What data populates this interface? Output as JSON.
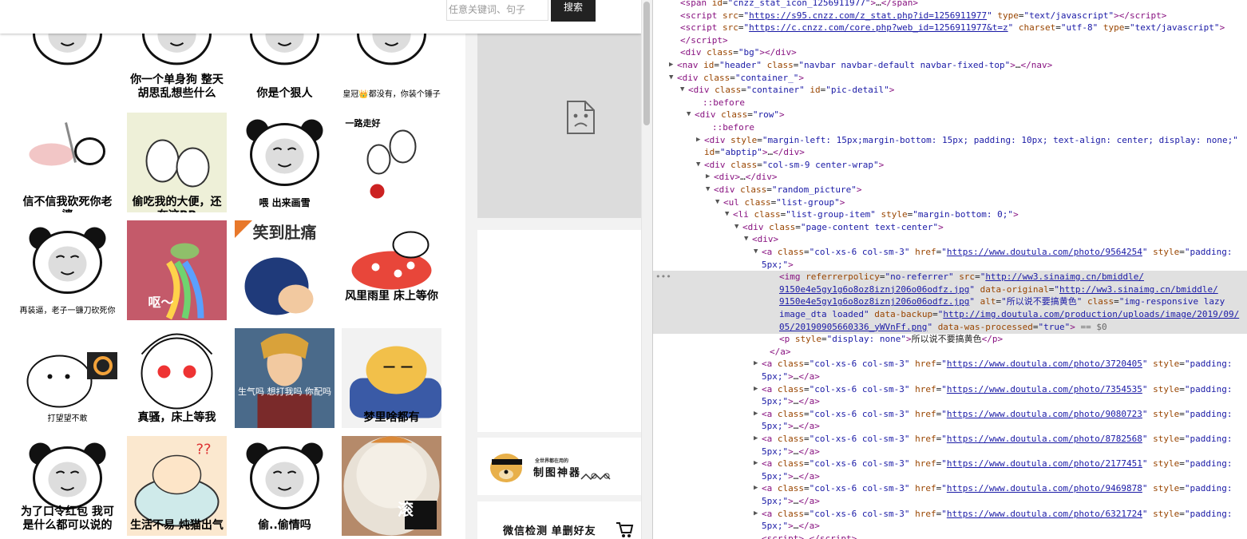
{
  "navbar": {
    "search_placeholder": "任意关键词、句子",
    "search_button": "搜索"
  },
  "memes": [
    {
      "caption": ""
    },
    {
      "caption": "你一个单身狗\n整天胡思乱想些什么"
    },
    {
      "caption": "你是个狠人"
    },
    {
      "caption": "皇冠👑都没有，你装个锤子"
    },
    {
      "caption": "信不信我砍死你老婆"
    },
    {
      "caption": "偷吃我的大便，还在这BB"
    },
    {
      "caption": "喂    出来画雪"
    },
    {
      "caption": "一路走好"
    },
    {
      "caption": "再装逼，老子一镰刀砍死你"
    },
    {
      "caption": "呕～"
    },
    {
      "caption": "笑到肚痛"
    },
    {
      "caption": "风里雨里\n床上等你"
    },
    {
      "caption": "打望望不敢"
    },
    {
      "caption": "真骚，床上等我"
    },
    {
      "caption": "生气吗 想打我吗 你配吗"
    },
    {
      "caption": "梦里啥都有"
    },
    {
      "caption": "为了口令红包\n我可是什么都可以说的"
    },
    {
      "caption": "生活不易 炖猫出气"
    },
    {
      "caption": "偷..偷情吗"
    },
    {
      "caption": "滚"
    }
  ],
  "ads": {
    "tool_small": "全世界都在用的",
    "tool_title": "制图神器",
    "wechat": "微信检测 单删好友"
  },
  "devtools": {
    "lines": [
      {
        "indent": 34,
        "html": "<span class='tag'>&lt;span</span> <span class='an'>id</span>=<span class='av'>\"cnzz_stat_icon_1256911977\"</span><span class='tag'>&gt;</span>…<span class='tag'>&lt;/span&gt;</span>"
      },
      {
        "indent": 34,
        "html": "<span class='tag'>&lt;script</span> <span class='an'>src</span>=<span class='av'>\"</span><span class='lnk'>https://s95.cnzz.com/z_stat.php?id=1256911977</span><span class='av'>\"</span> <span class='an'>type</span>=<span class='av'>\"text/javascript\"</span><span class='tag'>&gt;&lt;/script&gt;</span>"
      },
      {
        "indent": 34,
        "html": "<span class='tag'>&lt;script</span> <span class='an'>src</span>=<span class='av'>\"</span><span class='lnk'>https://c.cnzz.com/core.php?web_id=1256911977&amp;t=z</span><span class='av'>\"</span> <span class='an'>charset</span>=<span class='av'>\"utf-8\"</span> <span class='an'>type</span>=<span class='av'>\"text/javascript\"</span><span class='tag'>&gt;</span>"
      },
      {
        "indent": 34,
        "html": "<span class='tag'>&lt;/script&gt;</span>"
      },
      {
        "indent": 34,
        "html": "<span class='tag'>&lt;div</span> <span class='an'>class</span>=<span class='av'>\"bg\"</span><span class='tag'>&gt;&lt;/div&gt;</span>"
      },
      {
        "indent": 30,
        "tri": "▶",
        "html": "<span class='tag'>&lt;nav</span> <span class='an'>id</span>=<span class='av'>\"header\"</span> <span class='an'>class</span>=<span class='av'>\"navbar navbar-default navbar-fixed-top\"</span><span class='tag'>&gt;</span>…<span class='tag'>&lt;/nav&gt;</span>"
      },
      {
        "indent": 30,
        "tri": "▼",
        "html": "<span class='tag'>&lt;div</span> <span class='an'>class</span>=<span class='av'>\"container_\"</span><span class='tag'>&gt;</span>"
      },
      {
        "indent": 44,
        "tri": "▼",
        "html": "<span class='tag'>&lt;div</span> <span class='an'>class</span>=<span class='av'>\"container\"</span> <span class='an'>id</span>=<span class='av'>\"pic-detail\"</span><span class='tag'>&gt;</span>"
      },
      {
        "indent": 62,
        "html": "<span class='ps'>::before</span>"
      },
      {
        "indent": 52,
        "tri": "▼",
        "html": "<span class='tag'>&lt;div</span> <span class='an'>class</span>=<span class='av'>\"row\"</span><span class='tag'>&gt;</span>"
      },
      {
        "indent": 74,
        "html": "<span class='ps'>::before</span>"
      },
      {
        "indent": 64,
        "tri": "▶",
        "html": "<span class='tag'>&lt;div</span> <span class='an'>style</span>=<span class='av'>\"margin-left: 15px;margin-bottom: 15px; padding: 10px; text-align: center; display: none;\"</span>"
      },
      {
        "indent": 64,
        "html": "<span class='an'>id</span>=<span class='av'>\"abptip\"</span><span class='tag'>&gt;</span>…<span class='tag'>&lt;/div&gt;</span>"
      },
      {
        "indent": 64,
        "tri": "▼",
        "html": "<span class='tag'>&lt;div</span> <span class='an'>class</span>=<span class='av'>\"col-sm-9 center-wrap\"</span><span class='tag'>&gt;</span>"
      },
      {
        "indent": 76,
        "tri": "▶",
        "html": "<span class='tag'>&lt;div&gt;</span>…<span class='tag'>&lt;/div&gt;</span>"
      },
      {
        "indent": 76,
        "tri": "▼",
        "html": "<span class='tag'>&lt;div</span> <span class='an'>class</span>=<span class='av'>\"random_picture\"</span><span class='tag'>&gt;</span>"
      },
      {
        "indent": 88,
        "tri": "▼",
        "html": "<span class='tag'>&lt;ul</span> <span class='an'>class</span>=<span class='av'>\"list-group\"</span><span class='tag'>&gt;</span>"
      },
      {
        "indent": 100,
        "tri": "▼",
        "html": "<span class='tag'>&lt;li</span> <span class='an'>class</span>=<span class='av'>\"list-group-item\"</span> <span class='an'>style</span>=<span class='av'>\"margin-bottom: 0;\"</span><span class='tag'>&gt;</span>"
      },
      {
        "indent": 112,
        "tri": "▼",
        "html": "<span class='tag'>&lt;div</span> <span class='an'>class</span>=<span class='av'>\"page-content text-center\"</span><span class='tag'>&gt;</span>"
      },
      {
        "indent": 124,
        "tri": "▼",
        "html": "<span class='tag'>&lt;div&gt;</span>"
      },
      {
        "indent": 136,
        "tri": "▼",
        "html": "<span class='tag'>&lt;a</span> <span class='an'>class</span>=<span class='av'>\"col-xs-6 col-sm-3\"</span> <span class='an'>href</span>=<span class='av'>\"</span><span class='lnk'>https://www.doutula.com/photo/9564254</span><span class='av'>\"</span> <span class='an'>style</span>=<span class='av'>\"padding:</span>"
      },
      {
        "indent": 136,
        "html": "<span class='av'>5px;\"</span><span class='tag'>&gt;</span>"
      },
      {
        "indent": 158,
        "sel": true,
        "dots": true,
        "html": "<span class='tag'>&lt;img</span> <span class='an'>referrerpolicy</span>=<span class='av'>\"no-referrer\"</span> <span class='an'>src</span>=<span class='av'>\"</span><span class='lnk'>http://ww3.sinaimg.cn/bmiddle/</span>"
      },
      {
        "indent": 158,
        "sel": true,
        "html": "<span class='lnk'>9150e4e5gy1g6o8oz8iznj206o06odfz.jpg</span><span class='av'>\"</span> <span class='an'>data-original</span>=<span class='av'>\"</span><span class='lnk'>http://ww3.sinaimg.cn/bmiddle/</span>"
      },
      {
        "indent": 158,
        "sel": true,
        "html": "<span class='lnk'>9150e4e5gy1g6o8oz8iznj206o06odfz.jpg</span><span class='av'>\"</span> <span class='an'>alt</span>=<span class='av'>\"所以说不要搞黄色\"</span> <span class='an'>class</span>=<span class='av'>\"img-responsive lazy</span>"
      },
      {
        "indent": 158,
        "sel": true,
        "html": "<span class='av'>image_dta loaded\"</span> <span class='an'>data-backup</span>=<span class='av'>\"</span><span class='lnk'>http://img.doutula.com/production/uploads/image/2019/09/</span>"
      },
      {
        "indent": 158,
        "sel": true,
        "html": "<span class='lnk'>05/20190905660336_yWVnFf.png</span><span class='av'>\"</span> <span class='an'>data-was-processed</span>=<span class='av'>\"true\"</span><span class='tag'>&gt;</span> <span class='eq'>== $0</span>"
      },
      {
        "indent": 158,
        "html": "<span class='tag'>&lt;p</span> <span class='an'>style</span>=<span class='av'>\"display: none\"</span><span class='tag'>&gt;</span><span class='txt'>所以说不要搞黄色</span><span class='tag'>&lt;/p&gt;</span>"
      },
      {
        "indent": 146,
        "html": "<span class='tag'>&lt;/a&gt;</span>"
      },
      {
        "indent": 136,
        "tri": "▶",
        "html": "<span class='tag'>&lt;a</span> <span class='an'>class</span>=<span class='av'>\"col-xs-6 col-sm-3\"</span> <span class='an'>href</span>=<span class='av'>\"</span><span class='lnk'>https://www.doutula.com/photo/3720405</span><span class='av'>\"</span> <span class='an'>style</span>=<span class='av'>\"padding:</span>"
      },
      {
        "indent": 136,
        "html": "<span class='av'>5px;\"</span><span class='tag'>&gt;</span>…<span class='tag'>&lt;/a&gt;</span>"
      },
      {
        "indent": 136,
        "tri": "▶",
        "html": "<span class='tag'>&lt;a</span> <span class='an'>class</span>=<span class='av'>\"col-xs-6 col-sm-3\"</span> <span class='an'>href</span>=<span class='av'>\"</span><span class='lnk'>https://www.doutula.com/photo/7354535</span><span class='av'>\"</span> <span class='an'>style</span>=<span class='av'>\"padding:</span>"
      },
      {
        "indent": 136,
        "html": "<span class='av'>5px;\"</span><span class='tag'>&gt;</span>…<span class='tag'>&lt;/a&gt;</span>"
      },
      {
        "indent": 136,
        "tri": "▶",
        "html": "<span class='tag'>&lt;a</span> <span class='an'>class</span>=<span class='av'>\"col-xs-6 col-sm-3\"</span> <span class='an'>href</span>=<span class='av'>\"</span><span class='lnk'>https://www.doutula.com/photo/9080723</span><span class='av'>\"</span> <span class='an'>style</span>=<span class='av'>\"padding:</span>"
      },
      {
        "indent": 136,
        "html": "<span class='av'>5px;\"</span><span class='tag'>&gt;</span>…<span class='tag'>&lt;/a&gt;</span>"
      },
      {
        "indent": 136,
        "tri": "▶",
        "html": "<span class='tag'>&lt;a</span> <span class='an'>class</span>=<span class='av'>\"col-xs-6 col-sm-3\"</span> <span class='an'>href</span>=<span class='av'>\"</span><span class='lnk'>https://www.doutula.com/photo/8782568</span><span class='av'>\"</span> <span class='an'>style</span>=<span class='av'>\"padding:</span>"
      },
      {
        "indent": 136,
        "html": "<span class='av'>5px;\"</span><span class='tag'>&gt;</span>…<span class='tag'>&lt;/a&gt;</span>"
      },
      {
        "indent": 136,
        "tri": "▶",
        "html": "<span class='tag'>&lt;a</span> <span class='an'>class</span>=<span class='av'>\"col-xs-6 col-sm-3\"</span> <span class='an'>href</span>=<span class='av'>\"</span><span class='lnk'>https://www.doutula.com/photo/2177451</span><span class='av'>\"</span> <span class='an'>style</span>=<span class='av'>\"padding:</span>"
      },
      {
        "indent": 136,
        "html": "<span class='av'>5px;\"</span><span class='tag'>&gt;</span>…<span class='tag'>&lt;/a&gt;</span>"
      },
      {
        "indent": 136,
        "tri": "▶",
        "html": "<span class='tag'>&lt;a</span> <span class='an'>class</span>=<span class='av'>\"col-xs-6 col-sm-3\"</span> <span class='an'>href</span>=<span class='av'>\"</span><span class='lnk'>https://www.doutula.com/photo/9469878</span><span class='av'>\"</span> <span class='an'>style</span>=<span class='av'>\"padding:</span>"
      },
      {
        "indent": 136,
        "html": "<span class='av'>5px;\"</span><span class='tag'>&gt;</span>…<span class='tag'>&lt;/a&gt;</span>"
      },
      {
        "indent": 136,
        "tri": "▶",
        "html": "<span class='tag'>&lt;a</span> <span class='an'>class</span>=<span class='av'>\"col-xs-6 col-sm-3\"</span> <span class='an'>href</span>=<span class='av'>\"</span><span class='lnk'>https://www.doutula.com/photo/6321724</span><span class='av'>\"</span> <span class='an'>style</span>=<span class='av'>\"padding:</span>"
      },
      {
        "indent": 136,
        "html": "<span class='av'>5px;\"</span><span class='tag'>&gt;</span>…<span class='tag'>&lt;/a&gt;</span>"
      },
      {
        "indent": 136,
        "html": "<span class='tag'>&lt;script&gt;</span>…<span class='tag'>&lt;/script&gt;</span>"
      }
    ]
  }
}
